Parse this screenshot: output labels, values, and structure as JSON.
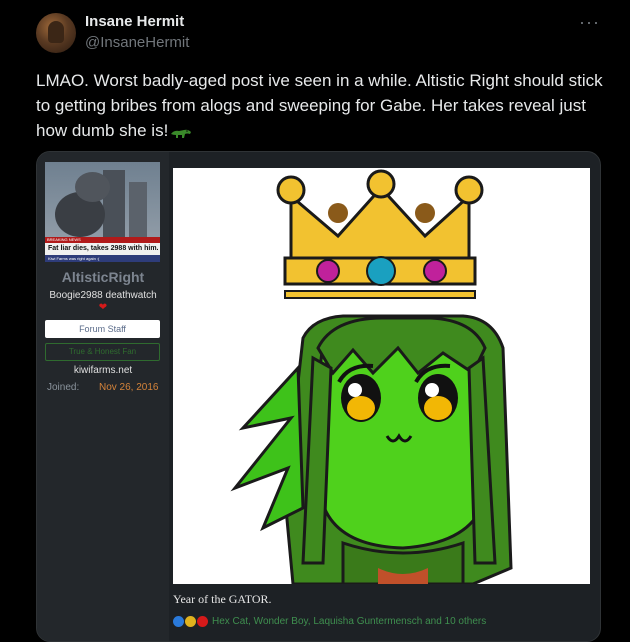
{
  "tweet": {
    "display_name": "Insane Hermit",
    "handle": "@InsaneHermit",
    "more_label": "···",
    "text": "LMAO. Worst badly-aged post ive seen in a while. Altistic Right should stick to getting bribes from alogs and sweeping for Gabe. Her takes reveal just how dumb she is!",
    "emoji": "crocodile-emoji"
  },
  "embedded_post": {
    "avatar_caption": {
      "banner": "BREAKING NEWS",
      "headline": "Fat liar dies, takes 2988 with him.",
      "subline": "Kiwi Farms was right again :("
    },
    "username": "AltisticRight",
    "user_title": "Boogie2988 deathwatch",
    "heart": "❤",
    "badge_staff": "Forum Staff",
    "badge_green": "True & Honest Fan",
    "site": "kiwifarms.net",
    "joined_label": "Joined:",
    "joined_value": "Nov 26, 2016",
    "caption": "Year of the GATOR.",
    "reactions_text": "Hex Cat, Wonder Boy, Laquisha Guntermensch and 10 others",
    "reaction_icons": [
      "like-icon",
      "winner-icon",
      "heart-icon"
    ]
  },
  "colors": {
    "background": "#000000",
    "text": "#e7e9ea",
    "muted": "#71767b",
    "card": "#1d2125",
    "joined_date": "#d4833a",
    "reactions": "#3f8f4f",
    "gator_green": "#3ec21a"
  }
}
